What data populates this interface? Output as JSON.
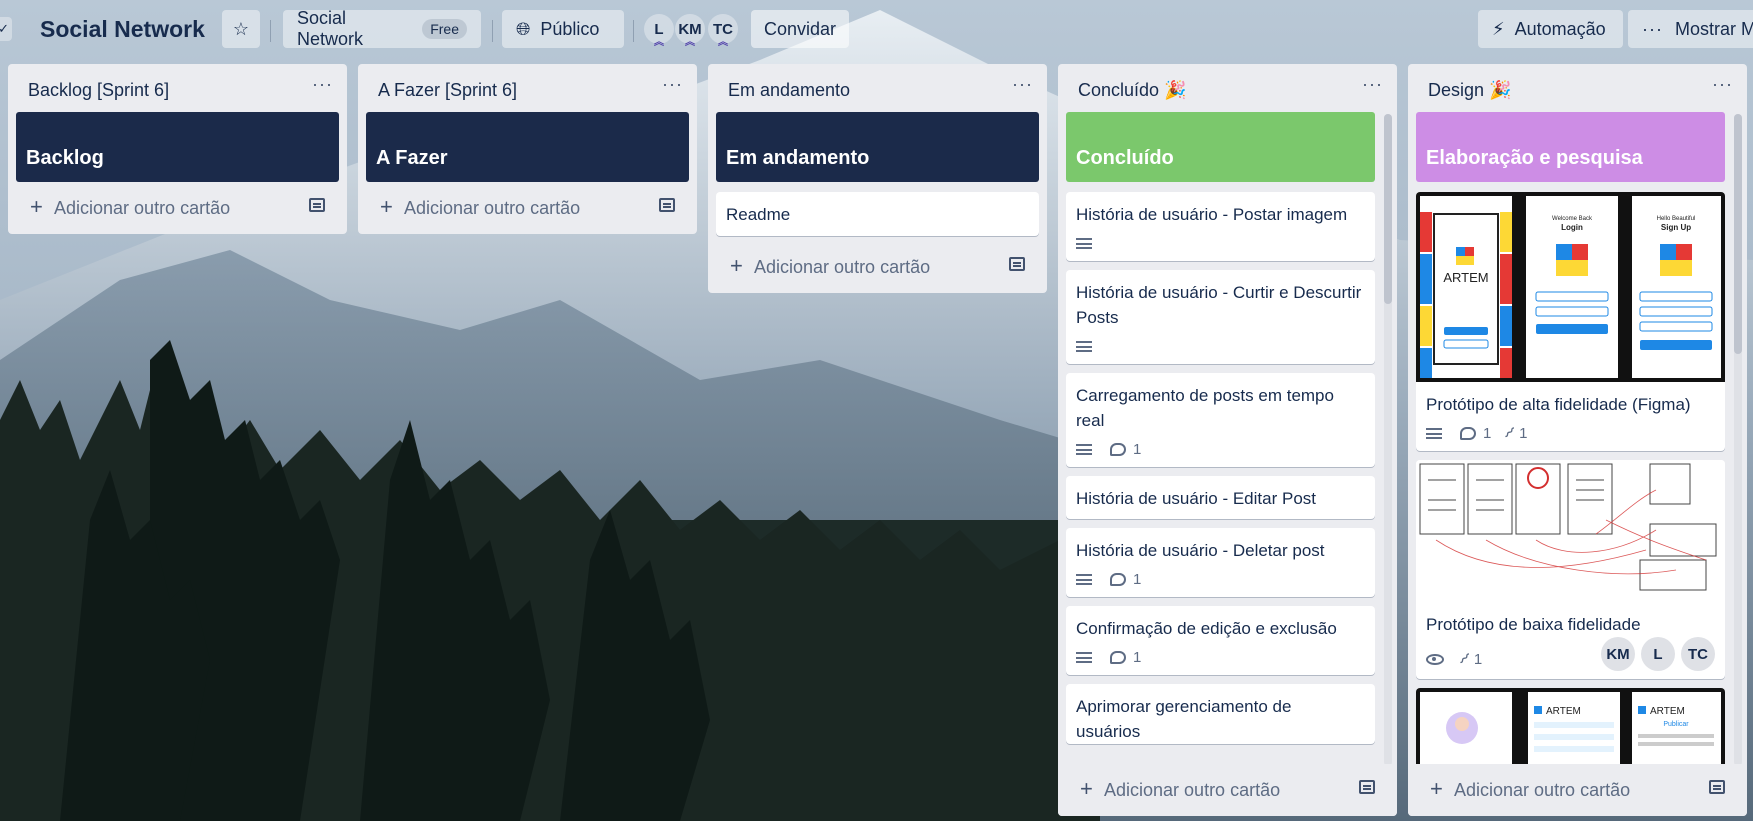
{
  "header": {
    "board_title": "Social Network",
    "workspace_label": "Social Network",
    "workspace_badge": "Free",
    "visibility_label": "Público",
    "members": [
      "L",
      "KM",
      "TC"
    ],
    "invite_label": "Convidar",
    "automation_label": "Automação",
    "menu_label": "Mostrar Me"
  },
  "common": {
    "add_card_label": "Adicionar outro cartão",
    "list_menu": "···"
  },
  "lists": [
    {
      "title": "Backlog [Sprint 6]",
      "banner": "Backlog",
      "cards": []
    },
    {
      "title": "A Fazer [Sprint 6]",
      "banner": "A Fazer",
      "cards": []
    },
    {
      "title": "Em andamento",
      "banner": "Em andamento",
      "cards": [
        {
          "title": "Readme"
        }
      ]
    },
    {
      "title": "Concluído 🎉",
      "banner": "Concluído",
      "cards": [
        {
          "title": "História de usuário - Postar imagem"
        },
        {
          "title": "História de usuário - Curtir e Descurtir Posts"
        },
        {
          "title": "Carregamento de posts em tempo real",
          "comments": "1"
        },
        {
          "title": "História de usuário - Editar Post"
        },
        {
          "title": "História de usuário - Deletar post",
          "comments": "1"
        },
        {
          "title": "Confirmação de edição e exclusão",
          "comments": "1"
        },
        {
          "title": "Aprimorar gerenciamento de usuários"
        }
      ]
    },
    {
      "title": "Design 🎉",
      "banner": "Elaboração e pesquisa",
      "cards": [
        {
          "title": "Protótipo de alta fidelidade (Figma)",
          "comments": "1",
          "attachments": "1",
          "cover_text": [
            "ARTEM",
            "Welcome Back",
            "Login",
            "Hello Beautiful",
            "Sign Up"
          ]
        },
        {
          "title": "Protótipo de baixa fidelidade",
          "attachments": "1",
          "members": [
            "KM",
            "L",
            "TC"
          ]
        },
        {
          "title": "",
          "cover_text": [
            "ARTEM",
            "ARTEM",
            "Publicar"
          ]
        }
      ]
    }
  ],
  "colors": {
    "banner_dark": "#1b2a4a",
    "banner_green": "#7bc86c",
    "banner_purple": "#cd8de5",
    "list_bg": "#ebecf0",
    "text": "#172b4d"
  }
}
